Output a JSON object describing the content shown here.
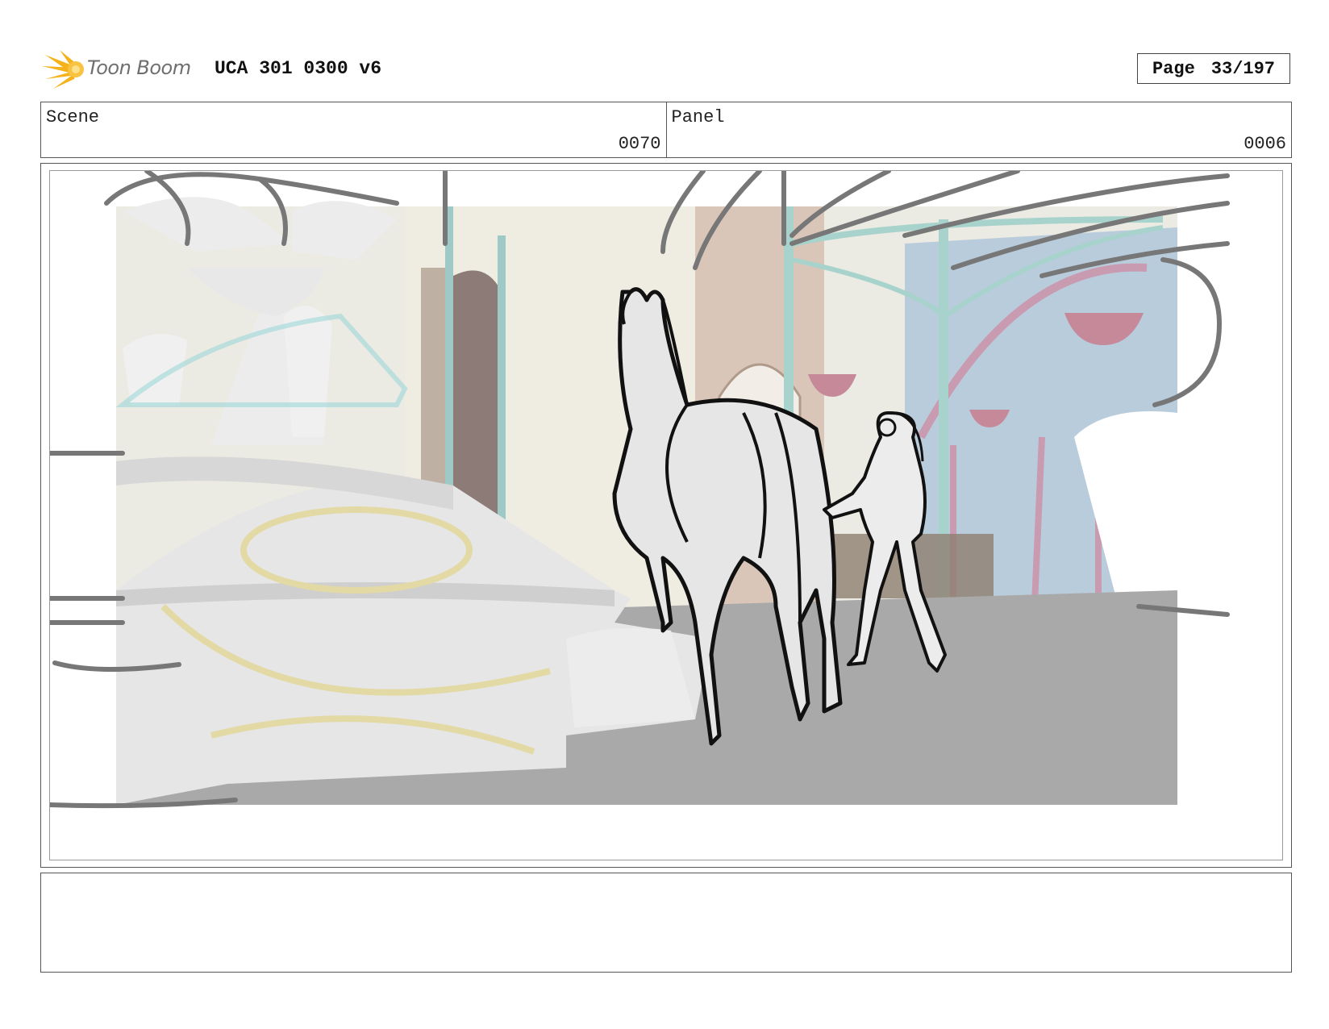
{
  "header": {
    "logo_text": "Toon Boom",
    "doc_title": "UCA 301 0300 v6",
    "page_label": "Page",
    "page_value": "33/197"
  },
  "info": {
    "scene_label": "Scene",
    "scene_value": "0070",
    "panel_label": "Panel",
    "panel_value": "0006"
  },
  "notes": {
    "text": ""
  },
  "colors": {
    "logo_accent": "#f5b21b",
    "frame_border": "#555555",
    "floor_gray": "#a9a9a9"
  },
  "icons": {
    "logo": "toon-boom-starburst-icon"
  }
}
